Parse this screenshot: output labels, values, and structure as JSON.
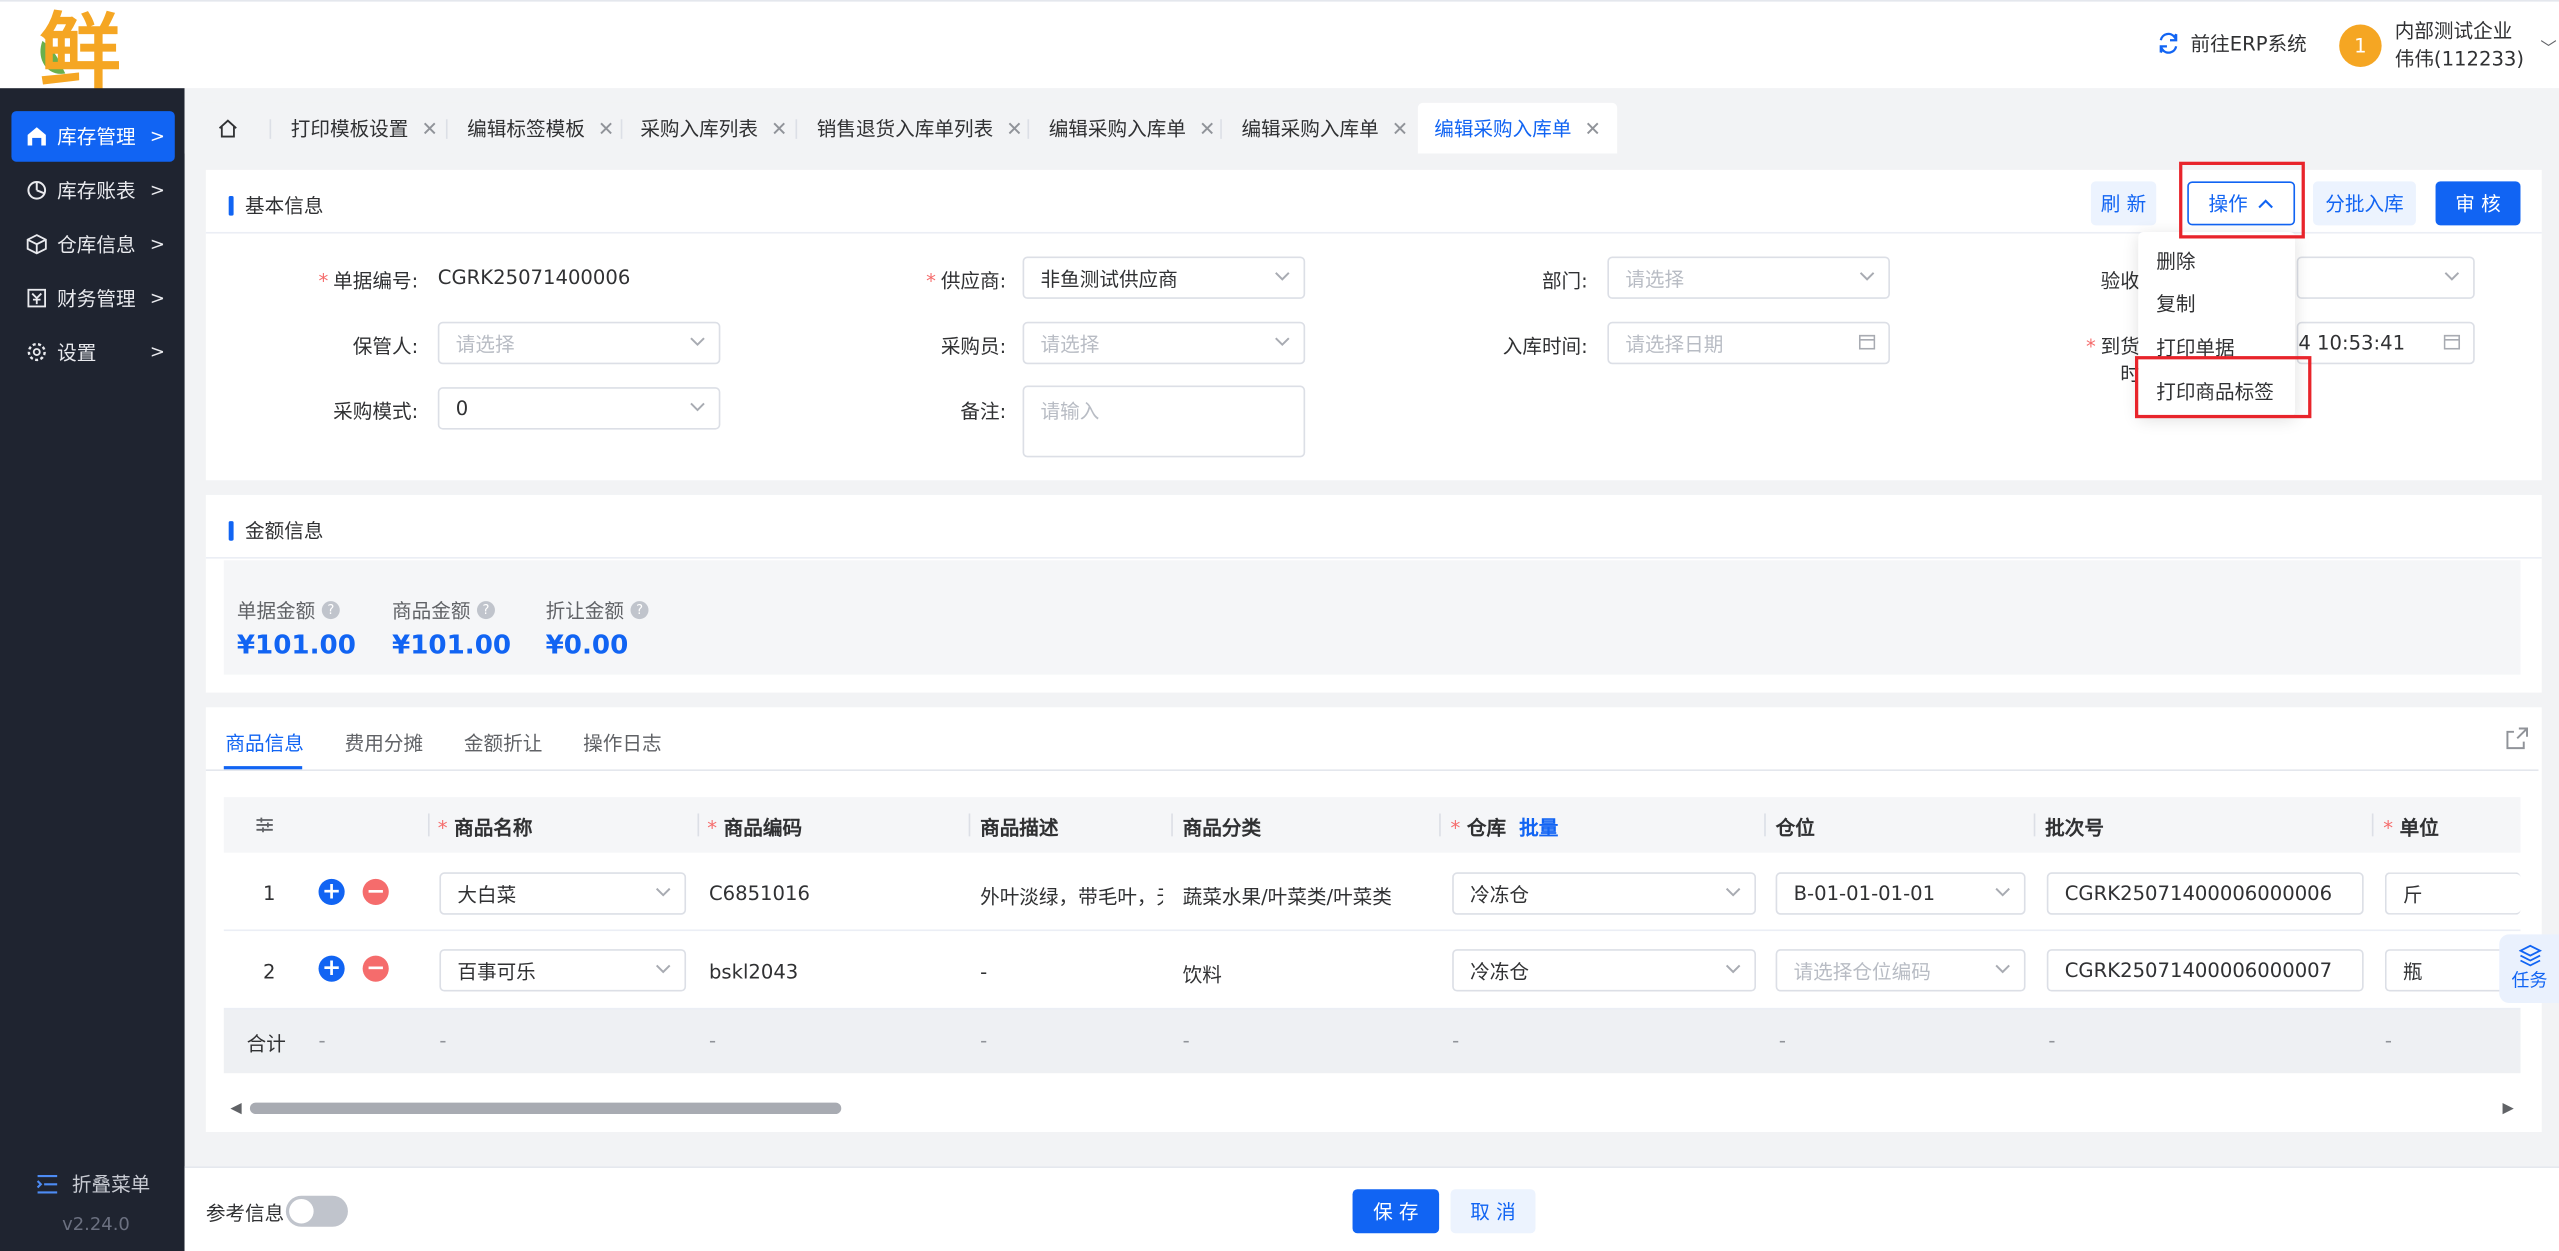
{
  "header": {
    "erp_link": "前往ERP系统",
    "user_badge": "1",
    "company": "内部测试企业",
    "username": "伟伟(112233)",
    "logo_char": "鲜"
  },
  "sidebar": {
    "items": [
      {
        "label": "库存管理",
        "icon": "warehouse-icon",
        "active": true
      },
      {
        "label": "库存账表",
        "icon": "pie-chart-icon"
      },
      {
        "label": "仓库信息",
        "icon": "box-icon"
      },
      {
        "label": "财务管理",
        "icon": "finance-icon"
      },
      {
        "label": "设置",
        "icon": "gear-icon"
      }
    ],
    "collapse": "折叠菜单",
    "version": "v2.24.0"
  },
  "tabs": [
    {
      "label": "打印模板设置"
    },
    {
      "label": "编辑标签模板"
    },
    {
      "label": "采购入库列表"
    },
    {
      "label": "销售退货入库单列表"
    },
    {
      "label": "编辑采购入库单"
    },
    {
      "label": "编辑采购入库单"
    },
    {
      "label": "编辑采购入库单",
      "active": true
    }
  ],
  "basic": {
    "title": "基本信息",
    "buttons": {
      "refresh": "刷 新",
      "operate": "操作",
      "batch": "分批入库",
      "audit": "审 核"
    },
    "dropdown": [
      "删除",
      "复制",
      "打印单据",
      "打印商品标签"
    ],
    "fields": {
      "doc_no_label": "单据编号:",
      "doc_no": "CGRK25071400006",
      "supplier_label": "供应商:",
      "supplier": "非鱼测试供应商",
      "dept_label": "部门:",
      "dept_placeholder": "请选择",
      "inspect_label": "验收",
      "keeper_label": "保管人:",
      "keeper_placeholder": "请选择",
      "buyer_label": "采购员:",
      "buyer_placeholder": "请选择",
      "in_time_label": "入库时间:",
      "in_time_placeholder": "请选择日期",
      "arrive_label": "到货时",
      "arrive_value": "4 10:53:41",
      "mode_label": "采购模式:",
      "mode": "0",
      "remark_label": "备注:",
      "remark_placeholder": "请输入"
    }
  },
  "amount": {
    "title": "金额信息",
    "items": [
      {
        "label": "单据金额",
        "value": "¥101.00"
      },
      {
        "label": "商品金额",
        "value": "¥101.00"
      },
      {
        "label": "折让金额",
        "value": "¥0.00"
      }
    ]
  },
  "product_tabs": [
    "商品信息",
    "费用分摊",
    "金额折让",
    "操作日志"
  ],
  "table": {
    "headers": {
      "name": "商品名称",
      "code": "商品编码",
      "desc": "商品描述",
      "category": "商品分类",
      "warehouse": "仓库",
      "batch_link": "批量",
      "location": "仓位",
      "batch_no": "批次号",
      "unit": "单位"
    },
    "rows": [
      {
        "idx": "1",
        "name": "大白菜",
        "code": "C6851016",
        "desc": "外叶淡绿，带毛叶，无",
        "category": "蔬菜水果/叶菜类/叶菜类",
        "warehouse": "冷冻仓",
        "location": "B-01-01-01-01",
        "batch_no": "CGRK25071400006000006",
        "unit": "斤"
      },
      {
        "idx": "2",
        "name": "百事可乐",
        "code": "bskl2043",
        "desc": "-",
        "category": "饮料",
        "warehouse": "冷冻仓",
        "location": "",
        "location_placeholder": "请选择仓位编码",
        "batch_no": "CGRK25071400006000007",
        "unit": "瓶"
      }
    ],
    "footer": {
      "label": "合计",
      "dash": "-"
    }
  },
  "footer": {
    "ref_label": "参考信息",
    "save": "保 存",
    "cancel": "取 消"
  },
  "float": {
    "task": "任务"
  },
  "colors": {
    "primary": "#1164f3",
    "danger": "#f56c6c",
    "highlight": "#e8242b",
    "sidebar": "#1f2430"
  }
}
